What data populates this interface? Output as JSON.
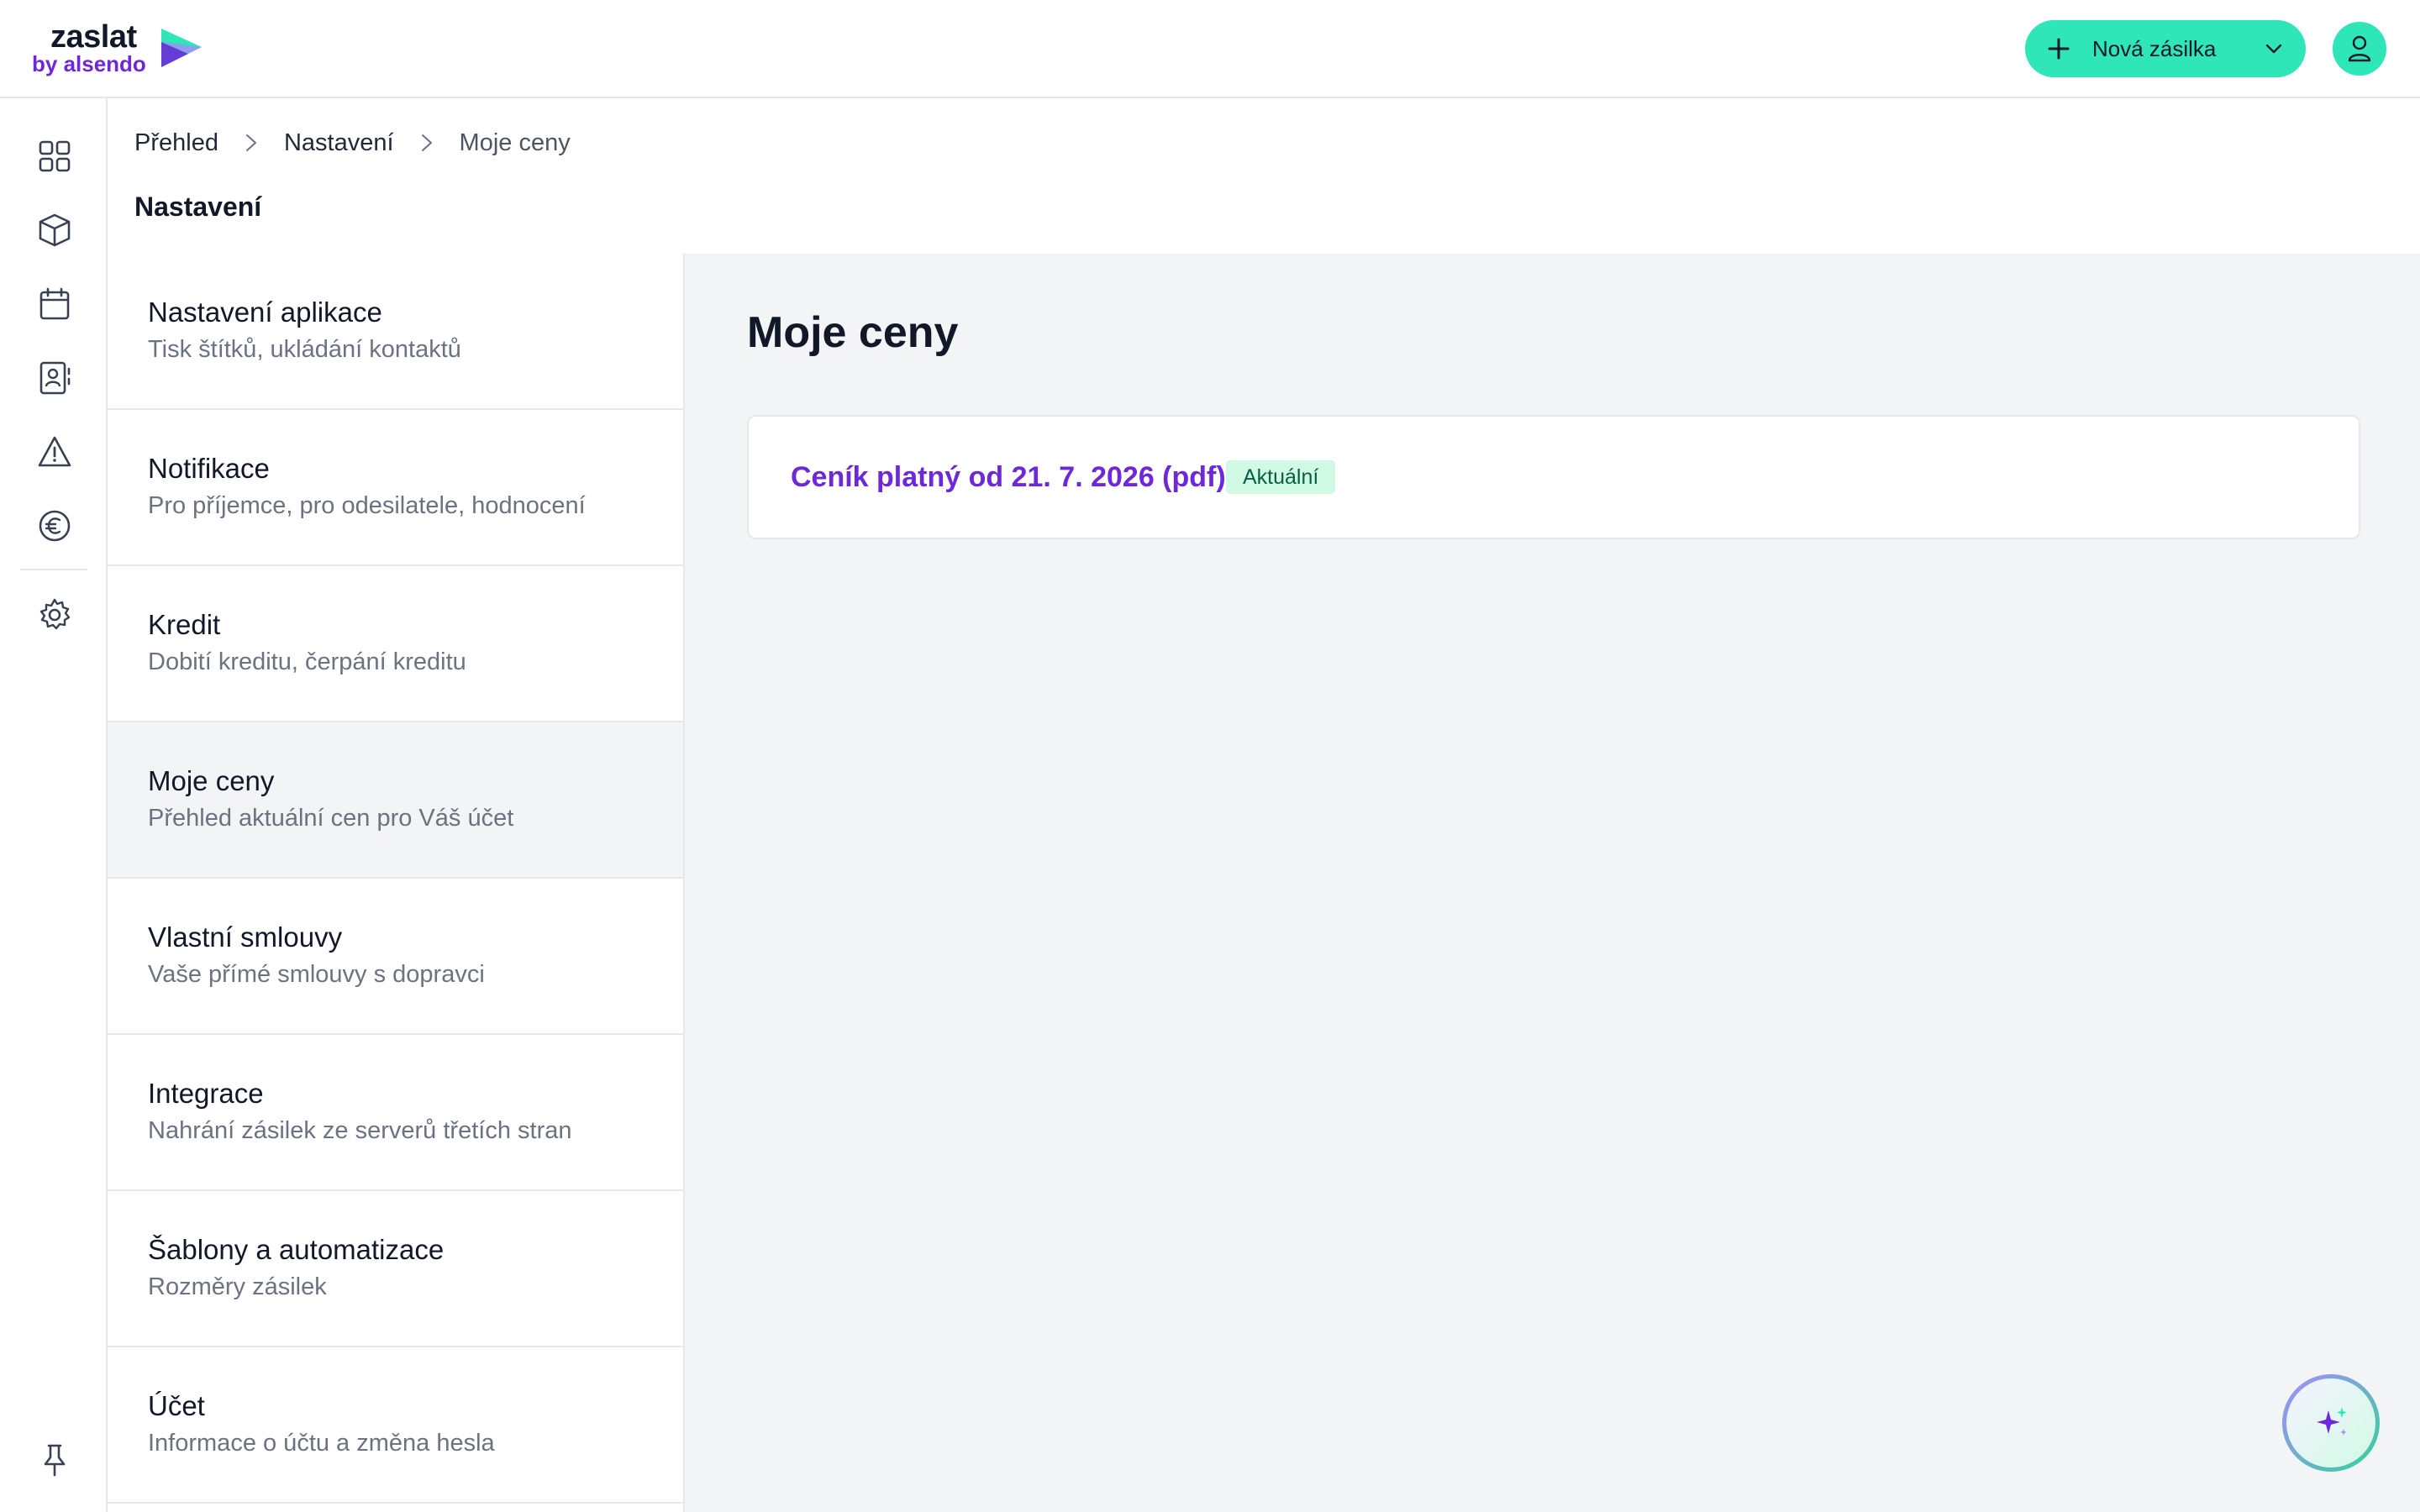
{
  "header": {
    "logo_text_main": "zaslat",
    "logo_text_sub": "by alsendo",
    "new_shipment_label": "Nová zásilka",
    "brand_color": "#2ee6b8",
    "accent_color": "#6d28d9"
  },
  "rail": {
    "icons": [
      "dashboard-icon",
      "package-icon",
      "calendar-icon",
      "contacts-icon",
      "warning-icon",
      "euro-icon",
      "gear-icon",
      "pin-icon"
    ]
  },
  "breadcrumb": {
    "items": [
      "Přehled",
      "Nastavení",
      "Moje ceny"
    ]
  },
  "section_title": "Nastavení",
  "settings_menu": {
    "items": [
      {
        "title": "Nastavení aplikace",
        "subtitle": "Tisk štítků, ukládání kontaktů"
      },
      {
        "title": "Notifikace",
        "subtitle": "Pro příjemce, pro odesilatele, hodnocení"
      },
      {
        "title": "Kredit",
        "subtitle": "Dobití kreditu, čerpání kreditu"
      },
      {
        "title": "Moje ceny",
        "subtitle": "Přehled aktuální cen pro Váš účet"
      },
      {
        "title": "Vlastní smlouvy",
        "subtitle": "Vaše přímé smlouvy s dopravci"
      },
      {
        "title": "Integrace",
        "subtitle": "Nahrání zásilek ze serverů třetích stran"
      },
      {
        "title": "Šablony a automatizace",
        "subtitle": "Rozměry zásilek"
      },
      {
        "title": "Účet",
        "subtitle": "Informace o účtu a změna hesla"
      }
    ],
    "active_index": 3
  },
  "main": {
    "page_title": "Moje ceny",
    "price_list_link": "Ceník platný od 21. 7. 2026 (pdf)",
    "badge": "Aktuální"
  }
}
